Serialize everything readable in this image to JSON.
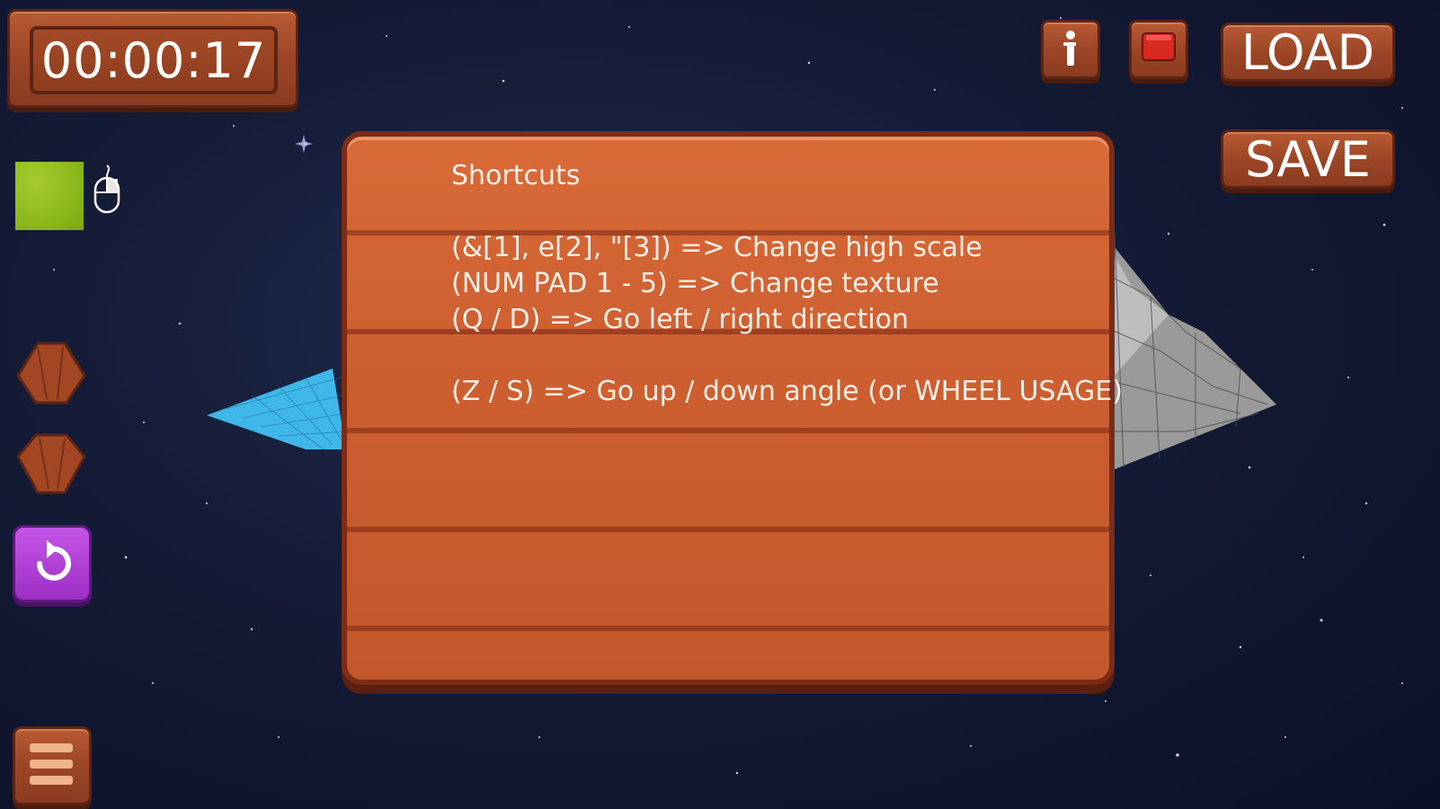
{
  "timer": {
    "value": "00:00:17"
  },
  "toolbar": {
    "load_label": "LOAD",
    "save_label": "SAVE"
  },
  "shortcuts": {
    "title": "Shortcuts",
    "lines": [
      "(&[1], e[2], \"[3]) => Change high scale",
      "(NUM PAD 1 - 5) => Change texture",
      "(Q / D) => Go left / right direction",
      "(Z / S) => Go up / down angle (or WHEEL USAGE)"
    ]
  },
  "icons": {
    "info": "info-icon",
    "stop": "stop-icon",
    "mouse": "mouse-icon",
    "raise": "raise-terrain-icon",
    "lower": "lower-terrain-icon",
    "undo": "undo-icon",
    "menu": "menu-icon"
  },
  "colors": {
    "wood": "#c4572c",
    "wood_dark": "#5c2414",
    "grass": "#8bb81e",
    "undo": "#b044d8",
    "space": "#141b36"
  }
}
